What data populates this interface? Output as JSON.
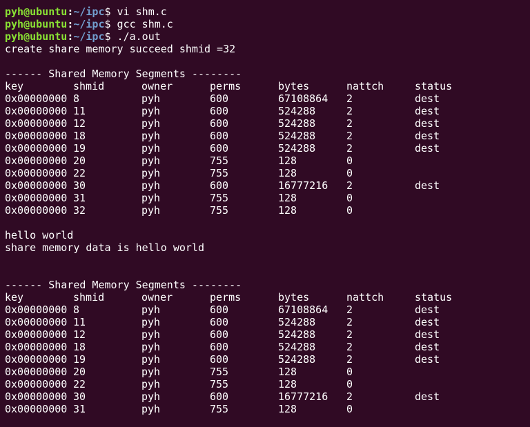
{
  "prompt": {
    "user_host": "pyh@ubuntu",
    "separator": ":",
    "path": "~/ipc",
    "symbol": "$"
  },
  "commands": [
    " vi shm.c",
    " gcc shm.c",
    " ./a.out"
  ],
  "output": {
    "create_msg": "create share memory succeed shmid =32",
    "segments_header": "------ Shared Memory Segments --------",
    "columns": [
      "key",
      "shmid",
      "owner",
      "perms",
      "bytes",
      "nattch",
      "status"
    ],
    "table1": [
      [
        "0x00000000",
        "8",
        "pyh",
        "600",
        "67108864",
        "2",
        "dest"
      ],
      [
        "0x00000000",
        "11",
        "pyh",
        "600",
        "524288",
        "2",
        "dest"
      ],
      [
        "0x00000000",
        "12",
        "pyh",
        "600",
        "524288",
        "2",
        "dest"
      ],
      [
        "0x00000000",
        "18",
        "pyh",
        "600",
        "524288",
        "2",
        "dest"
      ],
      [
        "0x00000000",
        "19",
        "pyh",
        "600",
        "524288",
        "2",
        "dest"
      ],
      [
        "0x00000000",
        "20",
        "pyh",
        "755",
        "128",
        "0",
        ""
      ],
      [
        "0x00000000",
        "22",
        "pyh",
        "755",
        "128",
        "0",
        ""
      ],
      [
        "0x00000000",
        "30",
        "pyh",
        "600",
        "16777216",
        "2",
        "dest"
      ],
      [
        "0x00000000",
        "31",
        "pyh",
        "755",
        "128",
        "0",
        ""
      ],
      [
        "0x00000000",
        "32",
        "pyh",
        "755",
        "128",
        "0",
        ""
      ]
    ],
    "hello_msg": "hello world",
    "data_msg": "share memory data is hello world",
    "table2": [
      [
        "0x00000000",
        "8",
        "pyh",
        "600",
        "67108864",
        "2",
        "dest"
      ],
      [
        "0x00000000",
        "11",
        "pyh",
        "600",
        "524288",
        "2",
        "dest"
      ],
      [
        "0x00000000",
        "12",
        "pyh",
        "600",
        "524288",
        "2",
        "dest"
      ],
      [
        "0x00000000",
        "18",
        "pyh",
        "600",
        "524288",
        "2",
        "dest"
      ],
      [
        "0x00000000",
        "19",
        "pyh",
        "600",
        "524288",
        "2",
        "dest"
      ],
      [
        "0x00000000",
        "20",
        "pyh",
        "755",
        "128",
        "0",
        ""
      ],
      [
        "0x00000000",
        "22",
        "pyh",
        "755",
        "128",
        "0",
        ""
      ],
      [
        "0x00000000",
        "30",
        "pyh",
        "600",
        "16777216",
        "2",
        "dest"
      ],
      [
        "0x00000000",
        "31",
        "pyh",
        "755",
        "128",
        "0",
        ""
      ]
    ]
  },
  "colors": {
    "background": "#300a24",
    "text": "#ffffff",
    "prompt_user": "#8ae234",
    "prompt_path": "#729fcf"
  }
}
